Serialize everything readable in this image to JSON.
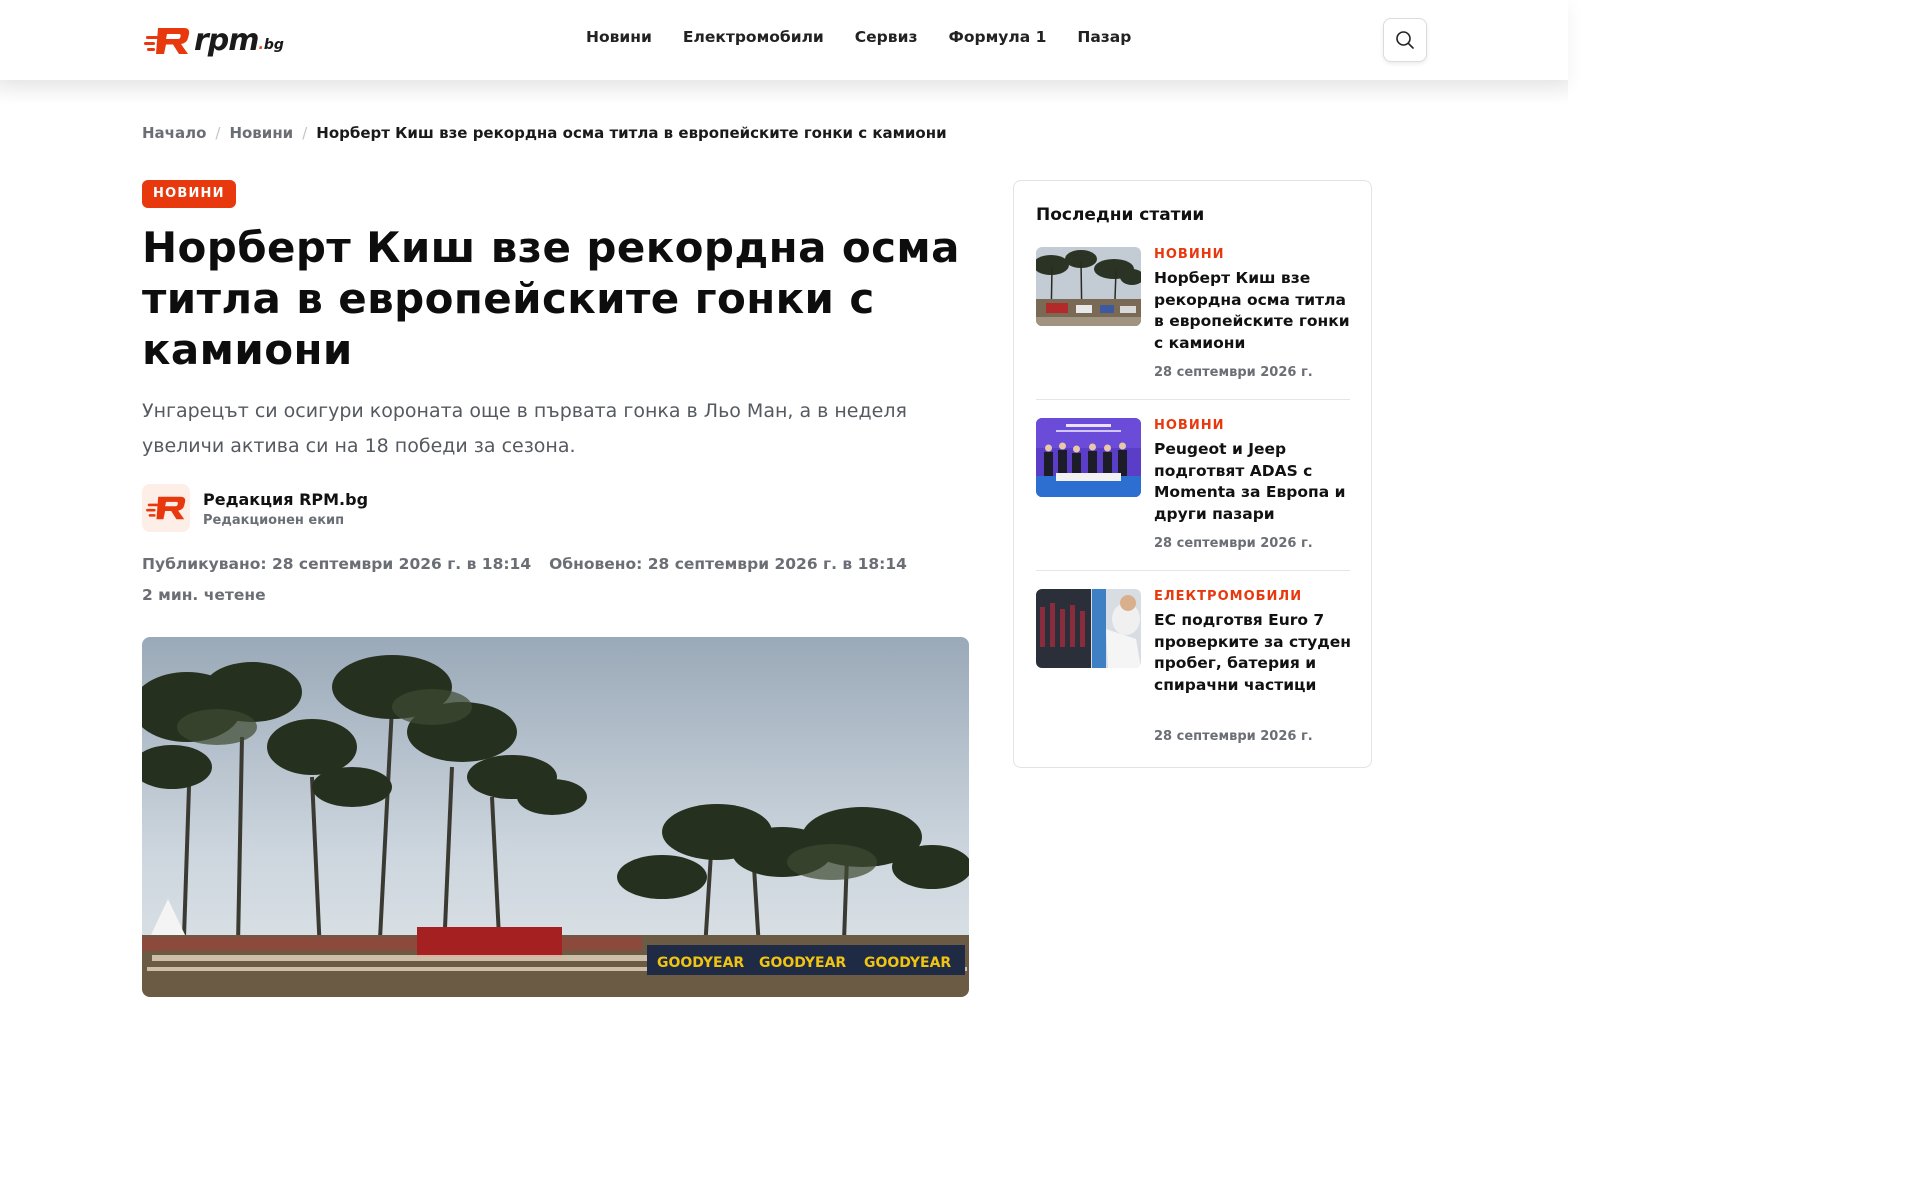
{
  "brand": {
    "logo_word": "rpm",
    "logo_dot": ".",
    "logo_tld": "bg"
  },
  "nav": {
    "items": [
      {
        "label": "Новини"
      },
      {
        "label": "Електромобили"
      },
      {
        "label": "Сервиз"
      },
      {
        "label": "Формула 1"
      },
      {
        "label": "Пазар"
      }
    ],
    "search_icon": "search-icon"
  },
  "breadcrumb": {
    "home": "Начало",
    "section": "Новини",
    "current": "Норберт Киш взе рекордна осма титла в европейските гонки с камиони",
    "separator": "/"
  },
  "article": {
    "category": "НОВИНИ",
    "title": "Норберт Киш взе рекордна осма титла в европейските гонки с камиони",
    "lead": "Унгарецът си осигури короната още в първата гонка в Льо Ман, а в неделя увеличи актива си на 18 победи за сезона.",
    "author": {
      "name": "Редакция RPM.bg",
      "role": "Редакционен екип"
    },
    "published": "Публикувано: 28 септември 2026 г. в 18:14",
    "updated": "Обновено: 28 септември 2026 г. в 18:14",
    "read_time": "2 мин. четене",
    "hero_banner_text": "GOODYEAR"
  },
  "sidebar": {
    "title": "Последни статии",
    "items": [
      {
        "category": "НОВИНИ",
        "headline": "Норберт Киш взе рекордна осма титла в европейските гонки с камиони",
        "date": "28 септември 2026 г."
      },
      {
        "category": "НОВИНИ",
        "headline": "Peugeot и Jeep подготвят ADAS с Momenta за Европа и други пазари",
        "date": "28 септември 2026 г."
      },
      {
        "category": "ЕЛЕКТРОМОБИЛИ",
        "headline": "ЕС подготвя Euro 7 проверките за студен пробег, батерия и спирачни частици",
        "date": "28 септември 2026 г."
      }
    ]
  },
  "colors": {
    "accent": "#e8380d",
    "text_primary": "#111111",
    "text_muted": "#6b6f75",
    "border": "#e3e3e3"
  }
}
